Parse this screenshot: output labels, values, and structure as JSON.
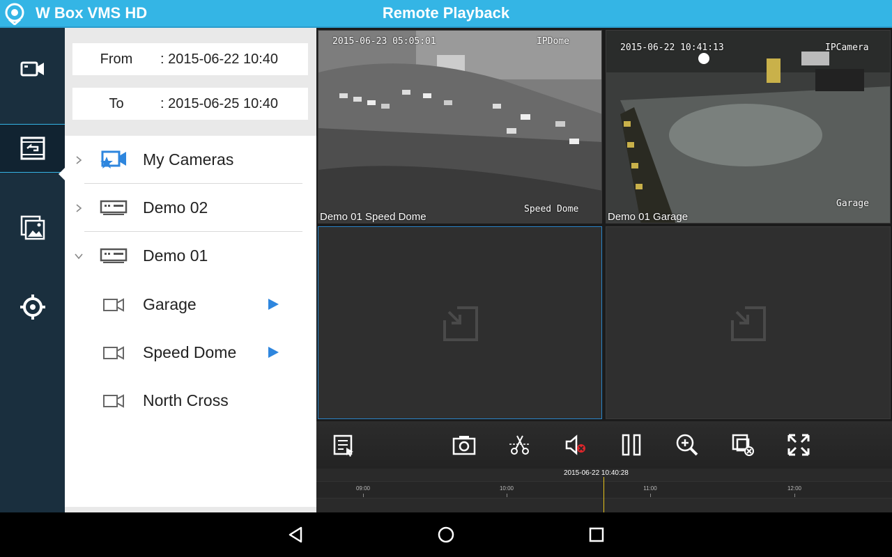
{
  "app": {
    "title": "W Box VMS HD",
    "page_title": "Remote Playback",
    "accent_color": "#34b5e5"
  },
  "rail": {
    "items": [
      {
        "icon": "video-camera-icon",
        "active": false
      },
      {
        "icon": "playback-icon",
        "active": true
      },
      {
        "icon": "gallery-icon",
        "active": false
      },
      {
        "icon": "settings-gear-icon",
        "active": false
      }
    ]
  },
  "date_range": {
    "from_label": "From",
    "from_value": ": 2015-06-22  10:40",
    "to_label": "To",
    "to_value": ": 2015-06-25  10:40"
  },
  "tree": {
    "my_cameras": "My Cameras",
    "demo02": "Demo 02",
    "demo01": "Demo 01",
    "cameras": [
      {
        "label": "Garage",
        "playing": true
      },
      {
        "label": "Speed Dome",
        "playing": true
      },
      {
        "label": "North Cross",
        "playing": false
      }
    ]
  },
  "grid": {
    "cell1": {
      "label": "Demo 01 Speed Dome",
      "osd_time": "2015-06-23 05:05:01",
      "osd_name": "IPDome",
      "osd_bottom": "Speed Dome"
    },
    "cell2": {
      "label": "Demo 01 Garage",
      "osd_time": "2015-06-22 10:41:13",
      "osd_name": "IPCamera",
      "osd_bottom": "Garage"
    }
  },
  "toolbar": {
    "buttons": [
      "record-list-icon",
      "snapshot-camera-icon",
      "scissors-clip-icon",
      "mute-icon",
      "pause-icon",
      "zoom-in-icon",
      "close-window-icon",
      "fullscreen-icon"
    ]
  },
  "timeline": {
    "current": "2015-06-22 10:40:28",
    "ticks": [
      "09:00",
      "10:00",
      "11:00",
      "12:00"
    ]
  }
}
